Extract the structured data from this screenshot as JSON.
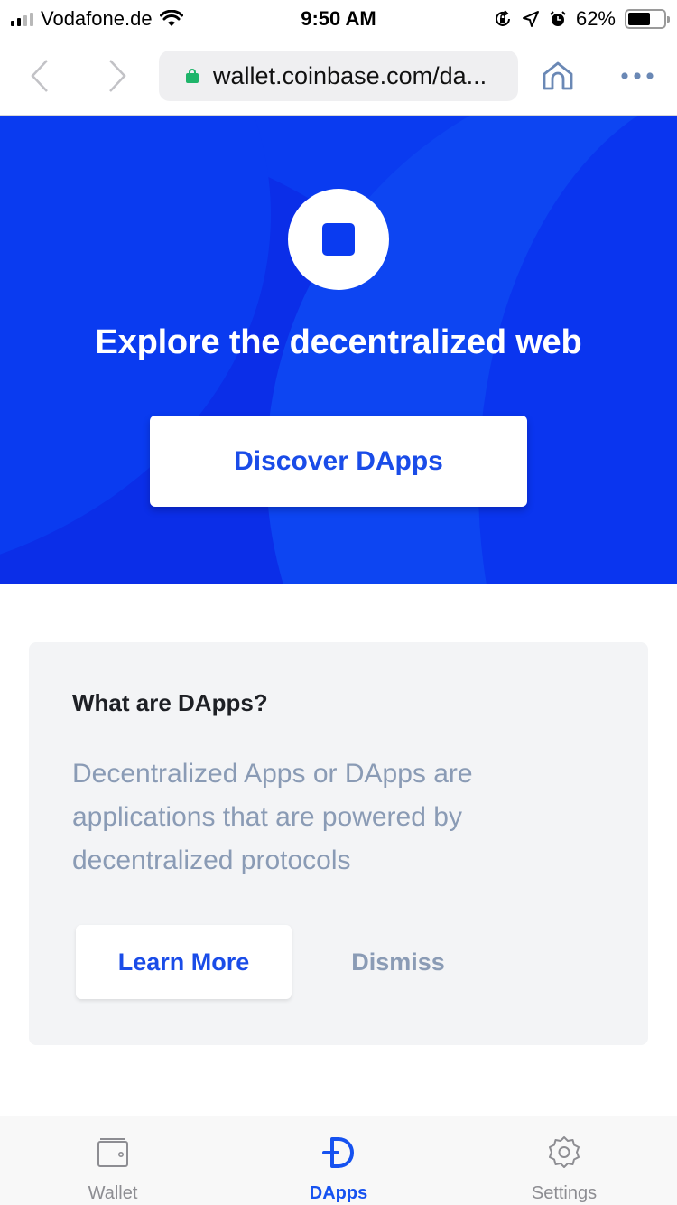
{
  "status_bar": {
    "carrier": "Vodafone.de",
    "time": "9:50 AM",
    "battery_percent_label": "62%",
    "battery_level": 0.62,
    "signal_bars_filled": 2,
    "signal_bars_total": 4,
    "icons": [
      "signal-icon",
      "wifi-icon",
      "orientation-lock-icon",
      "location-icon",
      "alarm-icon",
      "battery-icon"
    ]
  },
  "browser": {
    "url": "wallet.coinbase.com/da...",
    "icons": [
      "back-icon",
      "forward-icon",
      "lock-icon",
      "home-icon",
      "more-icon"
    ]
  },
  "hero": {
    "title": "Explore the decentralized web",
    "button_label": "Discover DApps",
    "colors": {
      "background": "#0a3bf0",
      "button_text": "#1a4ce8"
    }
  },
  "info_card": {
    "title": "What are DApps?",
    "description": "Decentralized Apps or DApps are applications that are powered by decentralized protocols",
    "learn_more_label": "Learn More",
    "dismiss_label": "Dismiss"
  },
  "tab_bar": {
    "active": "DApps",
    "active_color": "#1652f0",
    "items": [
      {
        "label": "Wallet",
        "icon": "wallet-icon"
      },
      {
        "label": "DApps",
        "icon": "dapps-icon"
      },
      {
        "label": "Settings",
        "icon": "settings-icon"
      }
    ]
  }
}
